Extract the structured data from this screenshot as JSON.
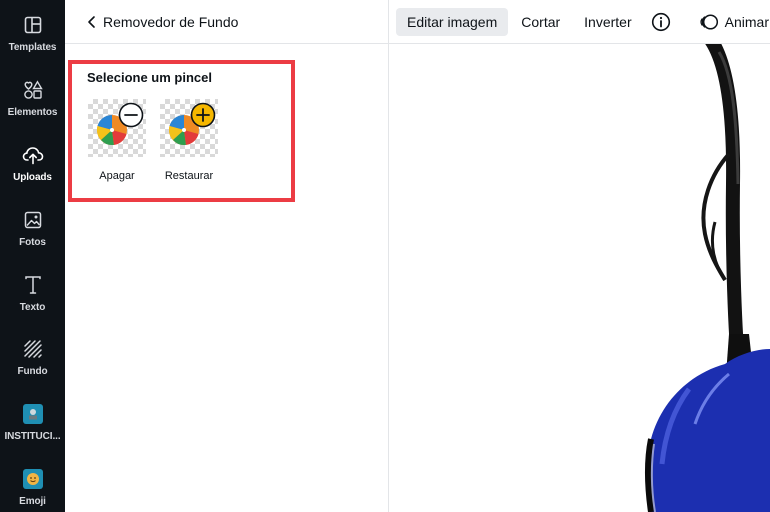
{
  "sidebar": {
    "items": [
      {
        "label": "Templates",
        "icon": "templates-icon"
      },
      {
        "label": "Elementos",
        "icon": "elements-icon"
      },
      {
        "label": "Uploads",
        "icon": "upload-cloud-icon"
      },
      {
        "label": "Fotos",
        "icon": "photo-icon"
      },
      {
        "label": "Texto",
        "icon": "text-icon"
      },
      {
        "label": "Fundo",
        "icon": "background-pattern-icon"
      },
      {
        "label": "INSTITUCI...",
        "icon": "app-thumbnail-icon"
      },
      {
        "label": "Emoji",
        "icon": "emoji-icon"
      }
    ],
    "active": "Uploads"
  },
  "panel": {
    "back_title": "Removedor de Fundo",
    "brush_section_title": "Selecione um pincel",
    "brushes": [
      {
        "label": "Apagar",
        "badge": "minus"
      },
      {
        "label": "Restaurar",
        "badge": "plus"
      }
    ]
  },
  "toolbar": {
    "edit_image": "Editar imagem",
    "crop": "Cortar",
    "flip": "Inverter",
    "animate": "Animar"
  },
  "colors": {
    "sidebar_bg": "#0e1318",
    "highlight_border": "#ec3c44",
    "lamp_blue": "#1c2fb0",
    "plus_badge": "#f5b700"
  }
}
